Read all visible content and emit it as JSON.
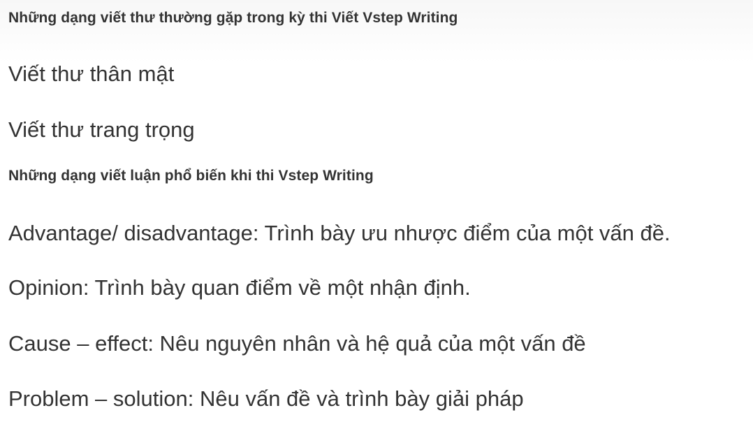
{
  "section_letters": {
    "heading": "Những dạng viết thư thường gặp trong kỳ thi Viết Vstep Writing",
    "items": [
      "Viết thư thân mật",
      "Viết thư trang trọng"
    ]
  },
  "section_essays": {
    "heading": "Những dạng viết luận phổ biến khi thi Vstep Writing",
    "items": [
      "Advantage/ disadvantage: Trình bày ưu nhược điểm của một vấn đề.",
      "Opinion: Trình bày quan điểm về một nhận định.",
      "Cause – effect: Nêu nguyên nhân và hệ quả của một vấn đề",
      "Problem – solution: Nêu vấn đề và trình bày giải pháp"
    ]
  }
}
